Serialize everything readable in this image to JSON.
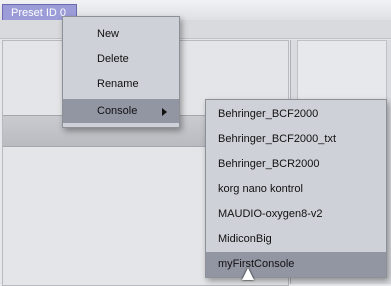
{
  "window": {
    "preset_tab_label": "Preset ID 0"
  },
  "context_menu": {
    "items": [
      {
        "label": "New"
      },
      {
        "label": "Delete"
      },
      {
        "label": "Rename"
      },
      {
        "label": "Console",
        "has_submenu": true,
        "active": true
      }
    ]
  },
  "console_submenu": {
    "items": [
      {
        "label": "Behringer_BCF2000"
      },
      {
        "label": "Behringer_BCF2000_txt"
      },
      {
        "label": "Behringer_BCR2000"
      },
      {
        "label": "korg nano kontrol"
      },
      {
        "label": "MAUDIO-oxygen8-v2"
      },
      {
        "label": "MidiconBig"
      },
      {
        "label": "myFirstConsole",
        "highlighted": true
      }
    ]
  },
  "icons": {
    "submenu_arrow": "triangle-right-icon",
    "cursor": "mouse-pointer-icon"
  },
  "colors": {
    "preset_tab_bg": "#9c9cd9",
    "menu_bg": "#cfd1d8",
    "menu_highlight": "#9296a3"
  }
}
